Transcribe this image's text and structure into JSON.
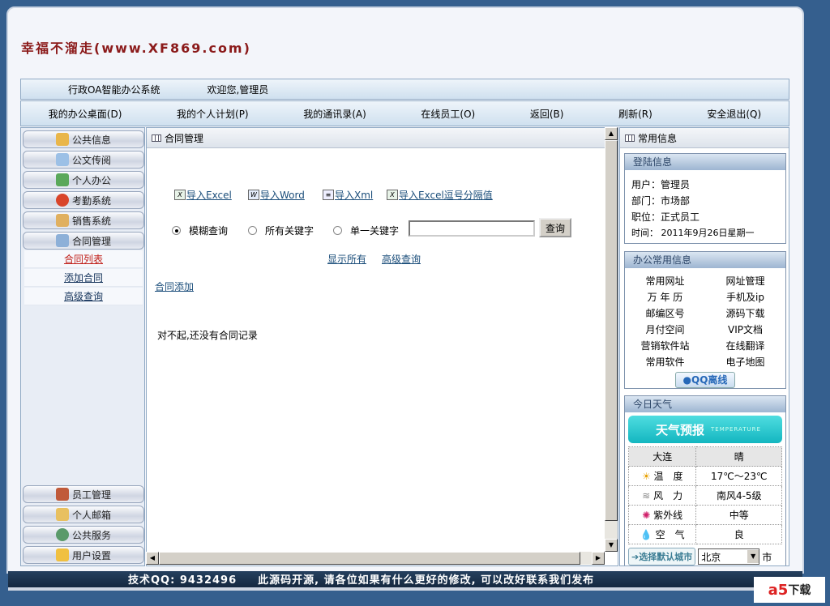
{
  "logo": "幸福不溜走(www.XF869.com)",
  "bar1": {
    "system": "行政OA智能办公系统",
    "welcome": "欢迎您,管理员"
  },
  "nav": [
    "我的办公桌面(D)",
    "我的个人计划(P)",
    "我的通讯录(A)",
    "在线员工(O)",
    "返回(B)",
    "刷新(R)",
    "安全退出(Q)"
  ],
  "sidebar": {
    "top": [
      "公共信息",
      "公文传阅",
      "个人办公",
      "考勤系统",
      "销售系统",
      "合同管理"
    ],
    "sub": [
      "合同列表",
      "添加合同",
      "高级查询"
    ],
    "bottom": [
      "员工管理",
      "个人邮箱",
      "公共服务",
      "用户设置"
    ]
  },
  "main": {
    "title": "合同管理",
    "imports": [
      "导入Excel",
      "导入Word",
      "导入Xml",
      "导入Excel逗号分隔值"
    ],
    "radios": [
      "模糊查询",
      "所有关键字",
      "单一关键字"
    ],
    "search_value": "",
    "search_button": "查询",
    "show_all": "显示所有",
    "advanced": "高级查询",
    "add": "合同添加",
    "empty": "对不起,还没有合同记录"
  },
  "right": {
    "title": "常用信息",
    "login_title": "登陆信息",
    "login": [
      "用户：管理员",
      "部门：市场部",
      "职位：正式员工",
      "时间： 2011年9月26日星期一"
    ],
    "office_title": "办公常用信息",
    "links": [
      "常用网址",
      "网址管理",
      "万 年 历",
      "手机及ip",
      "邮编区号",
      "源码下载",
      "月付空间",
      "VIP文档",
      "营销软件站",
      "在线翻译",
      "常用软件",
      "电子地图"
    ],
    "qq": "QQ离线",
    "weather_title": "今日天气",
    "banner": "天气预报",
    "banner_sub": "TEMPERATURE",
    "city": "大连",
    "condition": "晴",
    "rows": [
      [
        "温　度",
        "17℃～23℃"
      ],
      [
        "风　力",
        "南风4-5级"
      ],
      [
        "紫外线",
        "中等"
      ],
      [
        "空　气",
        "良"
      ]
    ],
    "choose_city": "选择默认城市",
    "city_select": "北京",
    "city_suffix": "市"
  },
  "footer": {
    "qq": "技术QQ: 9432496",
    "note": "此源码开源, 请各位如果有什么更好的修改, 可以改好联系我们发布"
  },
  "watermark": {
    "brand": "a5",
    "text": "下载"
  }
}
